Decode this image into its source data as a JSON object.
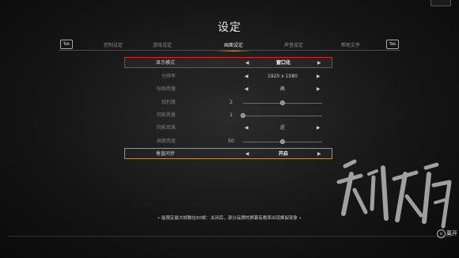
{
  "title": "设定",
  "tab_key_left": "Tab",
  "tab_key_right": "Tab",
  "tabs": [
    "控制设定",
    "游戏设定",
    "画面设定",
    "声音设定",
    "帮助文件"
  ],
  "active_tab_index": 2,
  "settings": [
    {
      "label": "显示模式",
      "kind": "select",
      "value": "窗口化",
      "state": "selected"
    },
    {
      "label": "分辨率",
      "kind": "select",
      "value": "1920 x 1080"
    },
    {
      "label": "贴图质量",
      "kind": "select",
      "value": "高"
    },
    {
      "label": "锐利度",
      "kind": "slider",
      "value": "2",
      "level": 0.5
    },
    {
      "label": "阴影质量",
      "kind": "slider",
      "value": "1",
      "level": 0.0
    },
    {
      "label": "阴影距离",
      "kind": "select",
      "value": "近"
    },
    {
      "label": "画面亮度",
      "kind": "slider",
      "value": "50",
      "level": 0.5
    },
    {
      "label": "垂直同步",
      "kind": "select",
      "value": "开启",
      "state": "focused"
    }
  ],
  "footer_note": "• 能限定最大帧数在60帧：关闭后，部分品牌的屏幕有概率出现撕裂现象 •",
  "close_key": "B",
  "close_label": "离开",
  "colors": {
    "highlight_red": "#d6252b",
    "focus_gold": "#b8913c",
    "tab_accent": "#c9a54a"
  }
}
